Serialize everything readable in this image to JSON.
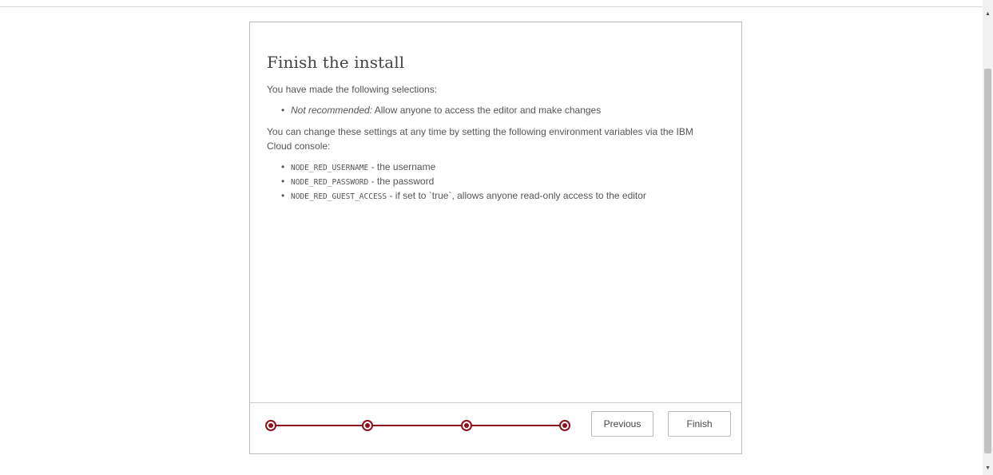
{
  "dialog": {
    "title": "Finish the install",
    "intro": "You have made the following selections:",
    "selections": [
      {
        "emphasis": "Not recommended:",
        "text": " Allow anyone to access the editor and make changes"
      }
    ],
    "change_note": "You can change these settings at any time by setting the following environment variables via the IBM Cloud console:",
    "env_vars": [
      {
        "name": "NODE_RED_USERNAME",
        "desc": " - the username"
      },
      {
        "name": "NODE_RED_PASSWORD",
        "desc": " - the password"
      },
      {
        "name": "NODE_RED_GUEST_ACCESS",
        "desc": " - if set to `true`, allows anyone read-only access to the editor"
      }
    ]
  },
  "footer": {
    "steps_total": 4,
    "current_step": 4,
    "previous_label": "Previous",
    "finish_label": "Finish"
  },
  "colors": {
    "accent": "#8c101c"
  },
  "icons": {
    "scroll_up": "scroll-up-arrow-icon",
    "scroll_down": "scroll-down-arrow-icon"
  }
}
